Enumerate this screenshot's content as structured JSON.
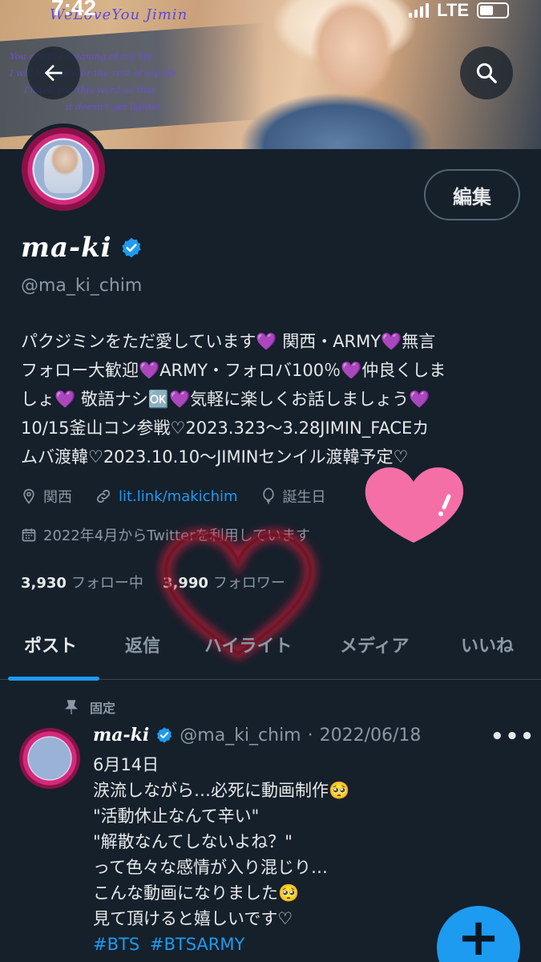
{
  "status_bar": {
    "time": "7:42",
    "network": "LTE"
  },
  "banner": {
    "title": "WeLoveYou  Jimin",
    "quote_lines": [
      "You are the meaning of my life",
      "I will love you for the rest of my life",
      "I'll tell you this word so that",
      "it doesn't get lighter"
    ]
  },
  "profile": {
    "edit_label": "編集",
    "display_name": "ma-ki",
    "handle": "@ma_ki_chim",
    "bio": "パクジミンをただ愛しています💜 関西・ARMY💜無言\nフォロー大歓迎💜ARMY・フォロバ100％💜仲良くしま\nしょ💜 敬語ナシ🆗💜気軽に楽しくお話しましょう💜\n10/15釜山コン参戦♡2023.323～3.28JIMIN_FACEカ\nムバ渡韓♡2023.10.10～JIMINセンイル渡韓予定♡",
    "location": "関西",
    "link": "lit.link/makichim",
    "birthday": "誕生日",
    "joined": "2022年4月からTwitterを利用しています",
    "following_count": "3,930",
    "following_label": "フォロー中",
    "followers_count": "3,990",
    "followers_label": "フォロワー"
  },
  "tabs": [
    "ポスト",
    "返信",
    "ハイライト",
    "メディア",
    "いいね"
  ],
  "pinned_tweet": {
    "pinned_label": "固定",
    "name": "ma-ki",
    "handle": "@ma_ki_chim",
    "date": "2022/06/18",
    "more": "•••",
    "lines": [
      "6月14日",
      "涙流しながら…必死に動画制作🥺",
      "\"活動休止なんて辛い\"",
      "\"解散なんてしないよね？\"",
      "って色々な感情が入り混じり…",
      "こんな動画になりました🥺",
      "見て頂けると嬉しいです♡"
    ],
    "hashtags": [
      "#BTS",
      "#BTSARMY"
    ]
  },
  "fab": {
    "icon": "plus-icon",
    "label": "+"
  },
  "colors": {
    "accent": "#1d9bf0",
    "background": "#15202b",
    "muted": "#8b98a5"
  }
}
